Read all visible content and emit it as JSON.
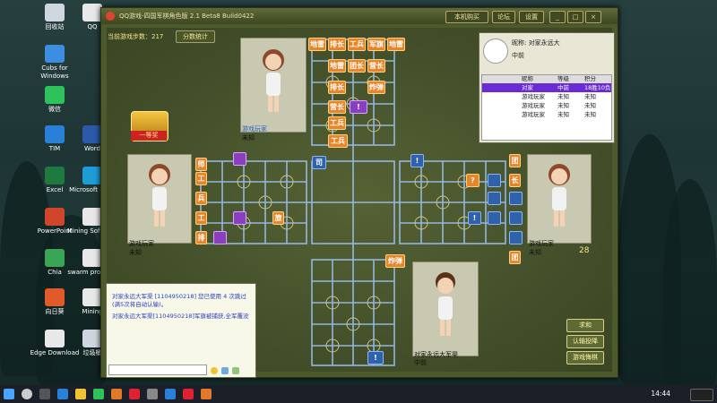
{
  "window": {
    "title": "QQ游戏-四国军棋角色版 2.1 Beta8 Build0422",
    "title_buttons": [
      "本机购买",
      "论坛",
      "设置"
    ]
  },
  "game": {
    "steps_label": "当前游戏步数：217",
    "stats_button": "分数统计"
  },
  "players": {
    "top": {
      "name": "游戏玩家",
      "sub": "未知"
    },
    "left": {
      "name": "游戏玩家",
      "sub": "未知"
    },
    "right": {
      "name": "游戏玩家",
      "sub": "未知",
      "timer": "28"
    },
    "bottom": {
      "name": "对家永远大军渠",
      "sub": "中前"
    }
  },
  "badge": "一等奖",
  "pieces_top": [
    "地雷",
    "排长",
    "工兵",
    "军旗",
    "地雷",
    "地雷",
    "团长",
    "营长",
    "排长",
    "炸弹",
    "营长",
    "!",
    "工兵"
  ],
  "pieces_left": [
    "师",
    "工",
    "兵",
    "工",
    "排",
    "旅"
  ],
  "pieces_right": [
    "!",
    "?",
    "!",
    "团",
    "长",
    "团"
  ],
  "center_pieces": [
    "司",
    "炸弹",
    "工兵",
    "!"
  ],
  "info": {
    "nick_label": "昵称: 对家永远大",
    "level_label": "中前",
    "table_headers": [
      "昵称",
      "等级",
      "积分"
    ],
    "rows": [
      [
        "对家",
        "中前",
        "18胜10负"
      ],
      [
        "游戏玩家",
        "未知",
        "未知"
      ],
      [
        "游戏玩家",
        "未知",
        "未知"
      ],
      [
        "游戏玩家",
        "未知",
        "未知"
      ]
    ]
  },
  "chat": {
    "messages": [
      "对家永远大军渠 [1104950218] 您已使用 4 次跳过(满5次将自动认输)。",
      "对家永远大军渠[1104950218]军旗被捕获,全军覆没"
    ]
  },
  "right_buttons": [
    "求和",
    "认输投降",
    "游戏悔棋"
  ],
  "desktop_icons": [
    {
      "label": "回收站"
    },
    {
      "label": "QQ"
    },
    {
      "label": "Cubs for Windows"
    },
    {
      "label": "微信"
    },
    {
      "label": "TIM"
    },
    {
      "label": "Excel"
    },
    {
      "label": "PowerPoint"
    },
    {
      "label": "Chia"
    },
    {
      "label": "向日葵"
    },
    {
      "label": "Edge Download"
    },
    {
      "label": "Word"
    },
    {
      "label": "Microsoft Edge"
    },
    {
      "label": "Mining Software"
    },
    {
      "label": "swarm program"
    },
    {
      "label": "Mining"
    },
    {
      "label": "垃圾桶"
    }
  ],
  "taskbar": {
    "time": "14:44"
  }
}
